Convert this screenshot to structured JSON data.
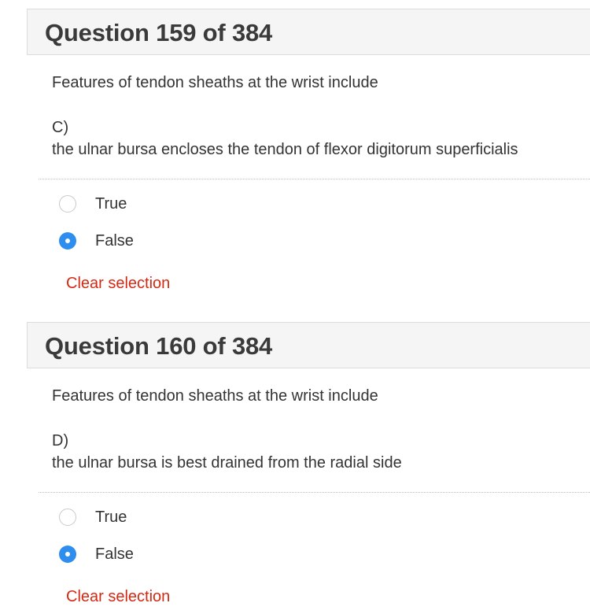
{
  "questions": [
    {
      "title": "Question 159 of 384",
      "stem": "Features of tendon sheaths at the wrist include",
      "option_letter": "C)",
      "option_text": "the ulnar bursa encloses the tendon of flexor digitorum superficialis",
      "answers": [
        {
          "label": "True",
          "selected": false
        },
        {
          "label": "False",
          "selected": true
        }
      ],
      "clear_label": "Clear selection"
    },
    {
      "title": "Question 160 of 384",
      "stem": "Features of tendon sheaths at the wrist include",
      "option_letter": "D)",
      "option_text": "the ulnar bursa is best drained from the radial side",
      "answers": [
        {
          "label": "True",
          "selected": false
        },
        {
          "label": "False",
          "selected": true
        }
      ],
      "clear_label": "Clear selection"
    }
  ],
  "colors": {
    "radio_selected": "#2e8ef0",
    "clear_link": "#d42a14",
    "header_bg": "#f5f5f5"
  }
}
